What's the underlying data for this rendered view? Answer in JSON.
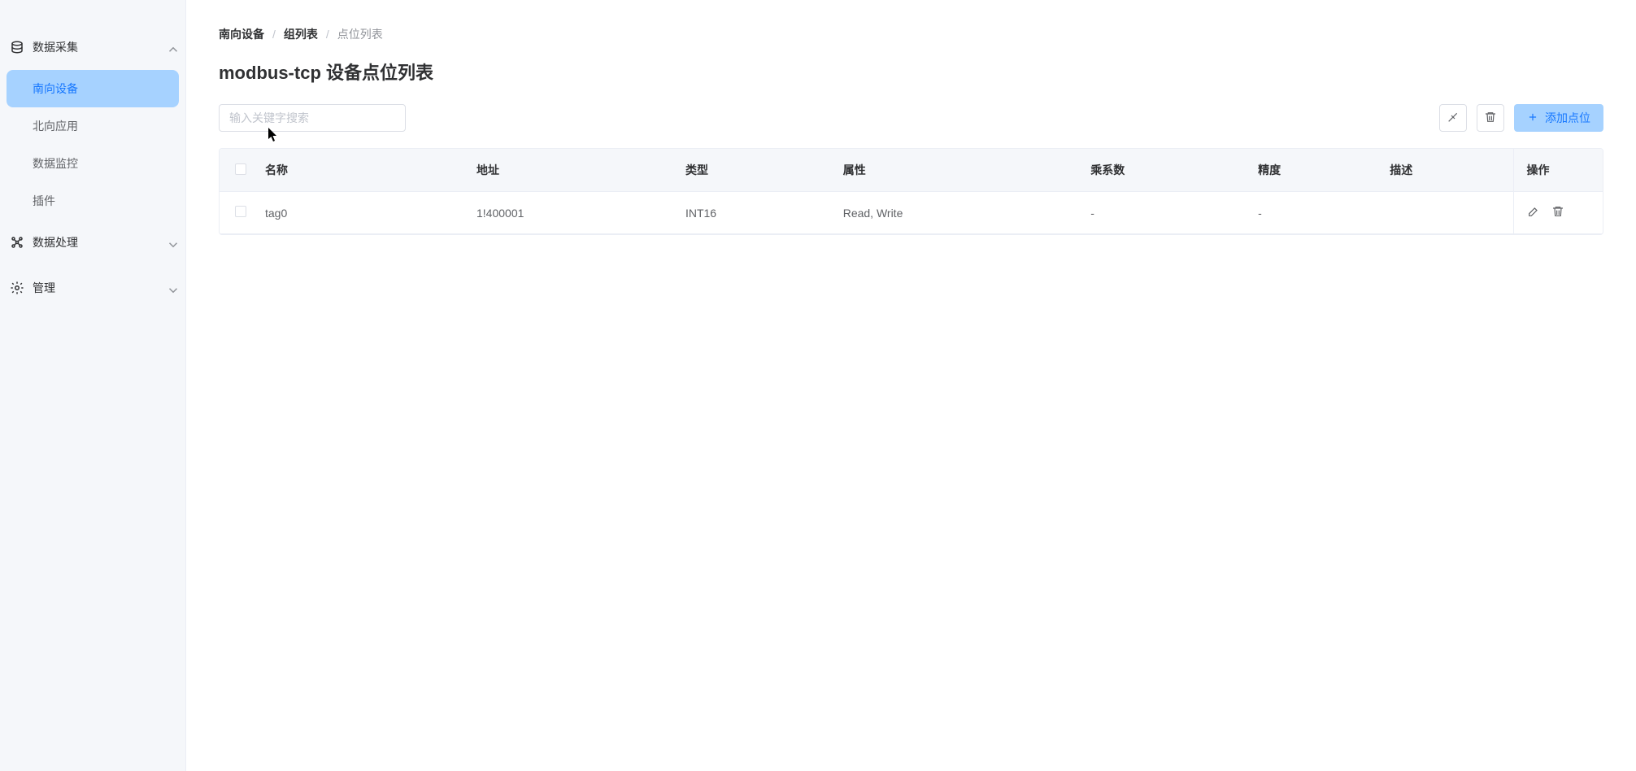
{
  "sidebar": {
    "groups": [
      {
        "label": "数据采集",
        "expanded": true,
        "children": [
          {
            "label": "南向设备",
            "active": true
          },
          {
            "label": "北向应用",
            "active": false
          },
          {
            "label": "数据监控",
            "active": false
          },
          {
            "label": "插件",
            "active": false
          }
        ]
      },
      {
        "label": "数据处理",
        "expanded": false
      },
      {
        "label": "管理",
        "expanded": false
      }
    ]
  },
  "breadcrumb": {
    "items": [
      "南向设备",
      "组列表"
    ],
    "current": "点位列表"
  },
  "page_title": "modbus-tcp 设备点位列表",
  "search": {
    "placeholder": "输入关键字搜索"
  },
  "toolbar": {
    "add_label": "添加点位"
  },
  "table": {
    "columns": {
      "name": "名称",
      "address": "地址",
      "type": "类型",
      "attribute": "属性",
      "multiplier": "乘系数",
      "precision": "精度",
      "description": "描述",
      "actions": "操作"
    },
    "rows": [
      {
        "name": "tag0",
        "address": "1!400001",
        "type": "INT16",
        "attribute": "Read, Write",
        "multiplier": "-",
        "precision": "-",
        "description": ""
      }
    ]
  }
}
